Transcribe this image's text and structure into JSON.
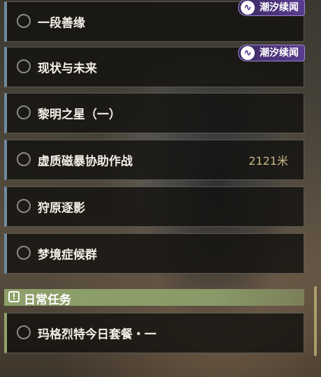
{
  "quests": [
    {
      "label": "一段善缘",
      "tag": "潮汐续闻"
    },
    {
      "label": "现状与未来",
      "tag": "潮汐续闻"
    },
    {
      "label": "黎明之星（一）"
    },
    {
      "label": "虚质磁暴协助作战",
      "distance": "2121米"
    },
    {
      "label": "狩原逐影"
    },
    {
      "label": "梦境症候群"
    }
  ],
  "daily_section": {
    "label": "日常任务",
    "icon": "exclamation-icon"
  },
  "daily_quests": [
    {
      "label": "玛格烈特今日套餐・一"
    }
  ],
  "colors": {
    "quest_accent": "#6f8aa0",
    "daily_accent": "#8fa36b",
    "tag_bg": "#5a3c8f",
    "distance_text": "#c9b685"
  }
}
